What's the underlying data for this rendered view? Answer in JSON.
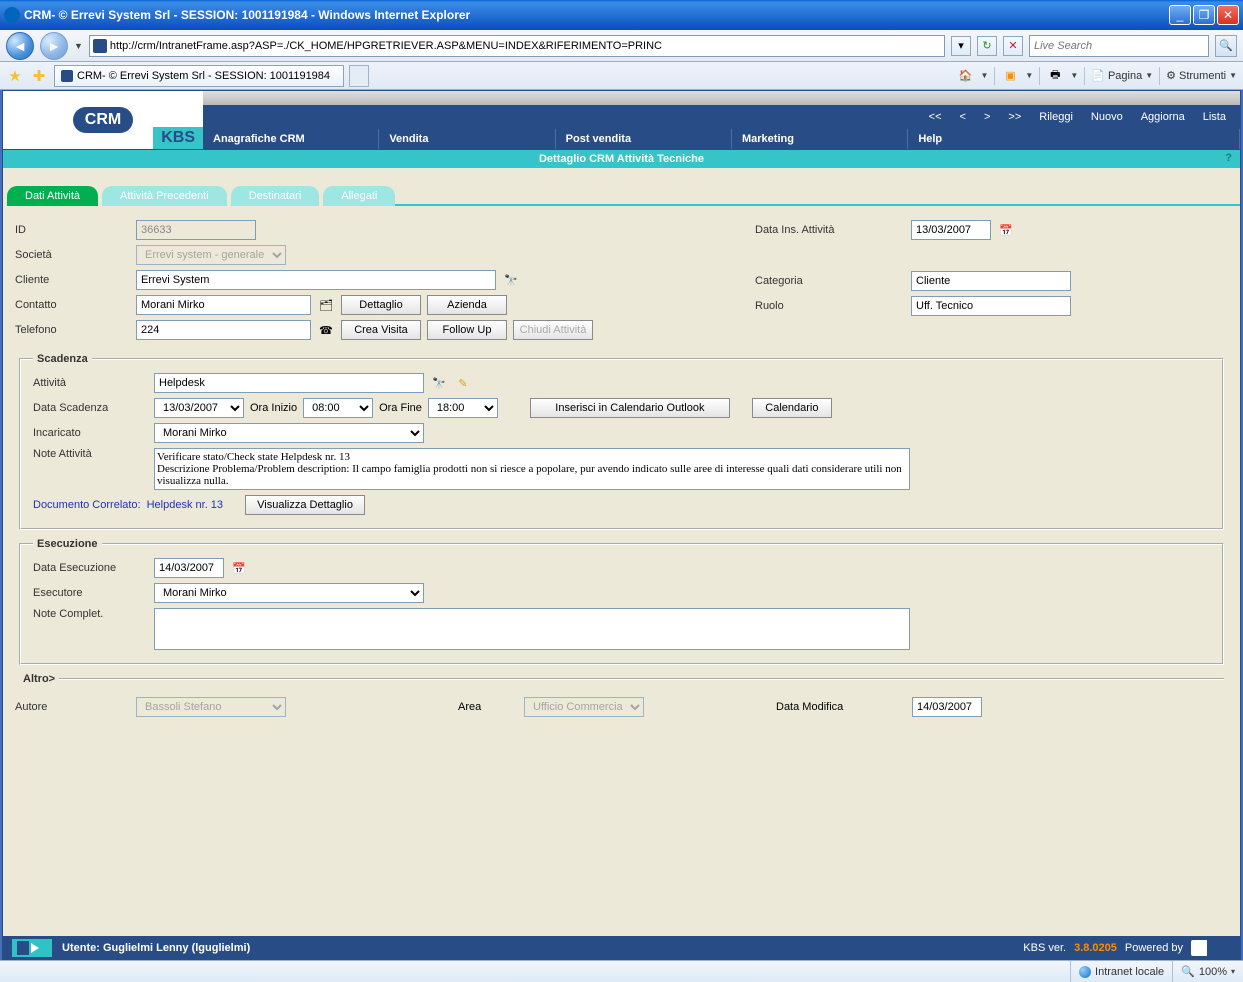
{
  "window": {
    "title": "CRM- © Errevi System Srl - SESSION: 1001191984 - Windows Internet Explorer"
  },
  "browser": {
    "url": "http://crm/IntranetFrame.asp?ASP=./CK_HOME/HPGRETRIEVER.ASP&MENU=INDEX&RIFERIMENTO=PRINC",
    "search_placeholder": "Live Search",
    "tab_title": "CRM- © Errevi System Srl - SESSION: 1001191984",
    "pagina": "Pagina",
    "strumenti": "Strumenti"
  },
  "crm": {
    "logo_text": "CRM",
    "logo_kbs": "KBS",
    "topnav": {
      "back2": "<<",
      "back1": "<",
      "fwd1": ">",
      "fwd2": ">>",
      "rileggi": "Rileggi",
      "nuovo": "Nuovo",
      "aggiorna": "Aggiorna",
      "lista": "Lista"
    },
    "menu": {
      "anagrafiche": "Anagrafiche CRM",
      "vendita": "Vendita",
      "post": "Post vendita",
      "marketing": "Marketing",
      "help": "Help"
    },
    "subtitle": "Dettaglio CRM Attività Tecniche"
  },
  "tabs": {
    "dati": "Dati Attività",
    "prec": "Attività Precedenti",
    "dest": "Destinatari",
    "alleg": "Allegati"
  },
  "labels": {
    "id": "ID",
    "societa": "Società",
    "cliente": "Cliente",
    "contatto": "Contatto",
    "telefono": "Telefono",
    "data_ins": "Data Ins. Attività",
    "categoria": "Categoria",
    "ruolo": "Ruolo",
    "dettaglio": "Dettaglio",
    "azienda": "Azienda",
    "crea_visita": "Crea Visita",
    "follow_up": "Follow Up",
    "chiudi": "Chiudi Attività",
    "scadenza": "Scadenza",
    "attivita": "Attività",
    "data_scadenza": "Data Scadenza",
    "ora_inizio": "Ora Inizio",
    "ora_fine": "Ora Fine",
    "inserisci_cal": "Inserisci in Calendario Outlook",
    "calendario": "Calendario",
    "incaricato": "Incaricato",
    "note_attivita": "Note Attività",
    "doc_correlato": "Documento Correlato:",
    "doc_link": "Helpdesk nr. 13",
    "vis_dett": "Visualizza Dettaglio",
    "esecuzione": "Esecuzione",
    "data_esec": "Data Esecuzione",
    "esecutore": "Esecutore",
    "note_compl": "Note Complet.",
    "altro": "Altro>",
    "autore": "Autore",
    "area": "Area",
    "data_modifica": "Data Modifica"
  },
  "values": {
    "id": "36633",
    "societa": "Errevi system - generale",
    "cliente": "Errevi System",
    "contatto": "Morani Mirko",
    "telefono": "224",
    "data_ins": "13/03/2007",
    "categoria": "Cliente",
    "ruolo": "Uff. Tecnico",
    "attivita": "Helpdesk",
    "data_scadenza": "13/03/2007",
    "ora_inizio": "08:00",
    "ora_fine": "18:00",
    "incaricato": "Morani Mirko",
    "note_attivita": "Verificare stato/Check state Helpdesk nr. 13\nDescrizione Problema/Problem description: Il campo famiglia prodotti non si riesce a popolare, pur avendo indicato sulle aree di interesse quali dati considerare utili non visualizza nulla.",
    "data_esec": "14/03/2007",
    "esecutore": "Morani Mirko",
    "note_compl": "",
    "autore": "Bassoli Stefano",
    "area": "Ufficio Commerciale",
    "data_modifica": "14/03/2007"
  },
  "footer": {
    "utente": "Utente: Guglielmi Lenny (lguglielmi)",
    "kbs_ver_label": "KBS ver.",
    "kbs_ver": "3.8.0205",
    "powered": "Powered by"
  },
  "status": {
    "zone": "Intranet locale",
    "zoom": "100%"
  }
}
